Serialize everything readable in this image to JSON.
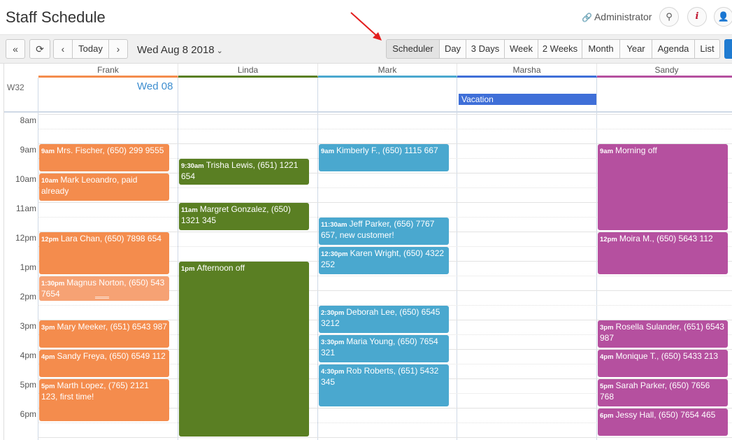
{
  "header": {
    "title": "Staff Schedule",
    "admin_label": "Administrator",
    "search_glyph": "⚲",
    "info_glyph": "i",
    "user_glyph": "👤"
  },
  "toolbar": {
    "collapse_glyph": "«",
    "refresh_glyph": "⟳",
    "prev_glyph": "‹",
    "today_label": "Today",
    "next_glyph": "›",
    "date_label": "Wed Aug 8 2018",
    "date_caret": "⌄",
    "views": [
      "Scheduler",
      "Day",
      "3 Days",
      "Week",
      "2 Weeks",
      "Month",
      "Year",
      "Agenda",
      "List"
    ],
    "active_view": "Scheduler"
  },
  "calendar": {
    "week_label": "W32",
    "date_label": "Wed 08",
    "resources": [
      {
        "name": "Frank",
        "color": "#f48c4d"
      },
      {
        "name": "Linda",
        "color": "#5a7f23"
      },
      {
        "name": "Mark",
        "color": "#4aa8cf"
      },
      {
        "name": "Marsha",
        "color": "#3f6fd8"
      },
      {
        "name": "Sandy",
        "color": "#b5509f"
      }
    ],
    "hours": [
      "8am",
      "9am",
      "10am",
      "11am",
      "12pm",
      "1pm",
      "2pm",
      "3pm",
      "4pm",
      "5pm",
      "6pm"
    ],
    "allday_event": {
      "resource": "Marsha",
      "title": "Vacation"
    },
    "events": {
      "frank": [
        {
          "time": "9am",
          "title": "Mrs. Fischer, (650) 299 9555"
        },
        {
          "time": "10am",
          "title": "Mark Leoandro, paid already"
        },
        {
          "time": "12pm",
          "title": "Lara Chan, (650) 7898 654"
        },
        {
          "time": "1:30pm",
          "title": "Magnus Norton, (650) 543 7654"
        },
        {
          "time": "3pm",
          "title": "Mary Meeker, (651) 6543 987"
        },
        {
          "time": "4pm",
          "title": "Sandy Freya, (650) 6549 112"
        },
        {
          "time": "5pm",
          "title": "Marth Lopez, (765) 2121 123, first time!"
        }
      ],
      "linda": [
        {
          "time": "9:30am",
          "title": "Trisha Lewis, (651) 1221 654"
        },
        {
          "time": "11am",
          "title": "Margret Gonzalez, (650) 1321 345"
        },
        {
          "time": "1pm",
          "title": "Afternoon off"
        }
      ],
      "mark": [
        {
          "time": "9am",
          "title": "Kimberly F., (650) 1115 667"
        },
        {
          "time": "11:30am",
          "title": "Jeff Parker, (656) 7767 657, new customer!"
        },
        {
          "time": "12:30pm",
          "title": "Karen Wright, (650) 4322 252"
        },
        {
          "time": "2:30pm",
          "title": "Deborah Lee, (650) 6545 3212"
        },
        {
          "time": "3:30pm",
          "title": "Maria Young, (650) 7654 321"
        },
        {
          "time": "4:30pm",
          "title": "Rob Roberts, (651) 5432 345"
        }
      ],
      "sandy": [
        {
          "time": "9am",
          "title": "Morning off"
        },
        {
          "time": "12pm",
          "title": "Moira M., (650) 5643 112"
        },
        {
          "time": "3pm",
          "title": "Rosella Sulander, (651) 6543 987"
        },
        {
          "time": "4pm",
          "title": "Monique T., (650) 5433 213"
        },
        {
          "time": "5pm",
          "title": "Sarah Parker, (650) 7656 768"
        },
        {
          "time": "6pm",
          "title": "Jessy Hall, (650) 7654 465"
        }
      ]
    }
  }
}
